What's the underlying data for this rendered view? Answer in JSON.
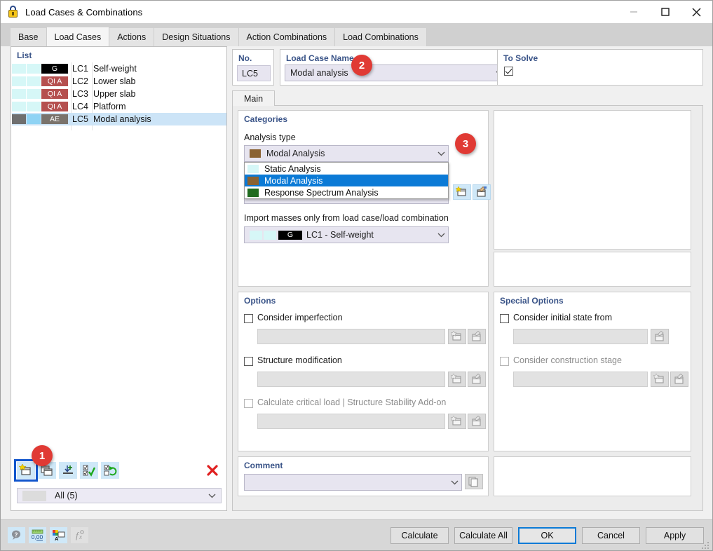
{
  "window": {
    "title": "Load Cases & Combinations",
    "icon": "padlock-icon",
    "minimize": "minimize-icon",
    "maximize": "maximize-icon",
    "close": "close-icon"
  },
  "tabs": [
    {
      "label": "Base",
      "active": false
    },
    {
      "label": "Load Cases",
      "active": true
    },
    {
      "label": "Actions",
      "active": false
    },
    {
      "label": "Design Situations",
      "active": false
    },
    {
      "label": "Action Combinations",
      "active": false
    },
    {
      "label": "Load Combinations",
      "active": false
    }
  ],
  "list_panel": {
    "title": "List",
    "rows": [
      {
        "no": "LC1",
        "name": "Self-weight",
        "badge": "G",
        "badge_color": "#000000",
        "sw1": "#d6f7f7",
        "sw2": "#d6f7f7",
        "selected": false
      },
      {
        "no": "LC2",
        "name": "Lower slab",
        "badge": "QI A",
        "badge_color": "#b5504f",
        "sw1": "#d6f7f7",
        "sw2": "#d6f7f7",
        "selected": false
      },
      {
        "no": "LC3",
        "name": "Upper slab",
        "badge": "QI A",
        "badge_color": "#b5504f",
        "sw1": "#d6f7f7",
        "sw2": "#d6f7f7",
        "selected": false
      },
      {
        "no": "LC4",
        "name": "Platform",
        "badge": "QI A",
        "badge_color": "#b5504f",
        "sw1": "#d6f7f7",
        "sw2": "#d6f7f7",
        "selected": false
      },
      {
        "no": "LC5",
        "name": "Modal analysis",
        "badge": "AE",
        "badge_color": "#7a736c",
        "sw1": "#6f6f6f",
        "sw2": "#8fd3f4",
        "selected": true
      }
    ],
    "toolbar": {
      "new": "new-load-case-icon",
      "copy": "copy-load-case-icon",
      "import": "import-load-case-icon",
      "select_all": "select-all-icon",
      "invert_selection": "invert-selection-icon",
      "delete": "delete-icon"
    },
    "filter_value": "All (5)"
  },
  "header": {
    "no_label": "No.",
    "no_value": "LC5",
    "name_label": "Load Case Name",
    "name_value": "Modal analysis",
    "to_solve_label": "To Solve",
    "to_solve_checked": true
  },
  "main_tab": {
    "label": "Main"
  },
  "categories": {
    "title": "Categories",
    "analysis_type_label": "Analysis type",
    "analysis_type_value": "Modal Analysis",
    "analysis_type_swatch": "#8a6232",
    "options": [
      {
        "label": "Static Analysis",
        "swatch": "#d6f7f7",
        "selected": false
      },
      {
        "label": "Modal Analysis",
        "swatch": "#8a6232",
        "selected": true
      },
      {
        "label": "Response Spectrum Analysis",
        "swatch": "#1f6b1f",
        "selected": false
      }
    ],
    "import_masses_label": "Import masses only from load case/load combination",
    "import_masses_value": "LC1 - Self-weight",
    "import_masses_badge": "G",
    "new_button": "new-icon",
    "edit_button": "edit-icon"
  },
  "options": {
    "title": "Options",
    "items": [
      {
        "label": "Consider imperfection",
        "checked": false,
        "enabled": true,
        "value": "",
        "buttons": [
          "new-icon",
          "edit-icon"
        ]
      },
      {
        "label": "Structure modification",
        "checked": false,
        "enabled": true,
        "value": "",
        "buttons": [
          "new-icon",
          "edit-icon"
        ]
      },
      {
        "label": "Calculate critical load | Structure Stability Add-on",
        "checked": false,
        "enabled": false,
        "value": "",
        "buttons": [
          "new-icon",
          "edit-icon"
        ]
      }
    ]
  },
  "special_options": {
    "title": "Special Options",
    "items": [
      {
        "label": "Consider initial state from",
        "checked": false,
        "enabled": true,
        "value": "",
        "buttons": [
          "edit-icon"
        ]
      },
      {
        "label": "Consider construction stage",
        "checked": false,
        "enabled": false,
        "value": "",
        "buttons": [
          "new-icon",
          "edit-icon"
        ]
      }
    ]
  },
  "comment": {
    "title": "Comment",
    "value": "",
    "copy_button": "copy-icon"
  },
  "footer": {
    "tool_icons": [
      "help-icon",
      "units-icon",
      "display-properties-icon",
      "formula-icon"
    ],
    "buttons": [
      {
        "label": "Calculate",
        "default": false
      },
      {
        "label": "Calculate All",
        "default": false
      },
      {
        "label": "OK",
        "default": true
      },
      {
        "label": "Cancel",
        "default": false
      },
      {
        "label": "Apply",
        "default": false
      }
    ]
  },
  "callouts": [
    {
      "number": "1"
    },
    {
      "number": "2"
    },
    {
      "number": "3"
    }
  ],
  "colors": {
    "accent": "#0b7ad6",
    "callout": "#e03a34",
    "group_title": "#3a5488",
    "selection": "#cce4f7"
  }
}
